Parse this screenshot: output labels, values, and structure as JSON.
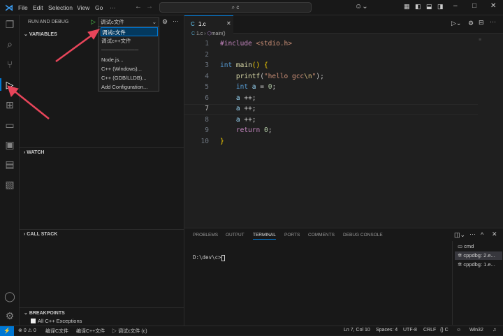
{
  "menu": [
    "File",
    "Edit",
    "Selection",
    "View",
    "Go",
    "···"
  ],
  "search": "c",
  "sidebar": {
    "title": "RUN AND DEBUG",
    "config": "调试c文件",
    "sections": {
      "variables": "VARIABLES",
      "watch": "WATCH",
      "callstack": "CALL STACK",
      "breakpoints": "BREAKPOINTS"
    },
    "breakpoint_item": "All C++ Exceptions"
  },
  "dropdown": [
    "调试c文件",
    "调试c++文件",
    "──────────",
    "Node.js...",
    "C++ (Windows)...",
    "C++ (GDB/LLDB)...",
    "Add Configuration..."
  ],
  "editor": {
    "tab": "1.c",
    "breadcrumb_file": "1.c",
    "breadcrumb_symbol": "main()",
    "lines": [
      "1",
      "2",
      "3",
      "4",
      "5",
      "6",
      "7",
      "8",
      "9",
      "10"
    ]
  },
  "panel": {
    "tabs": [
      "PROBLEMS",
      "OUTPUT",
      "TERMINAL",
      "PORTS",
      "COMMENTS",
      "DEBUG CONSOLE"
    ],
    "prompt": "D:\\dev\\c>",
    "terminals": [
      "cmd",
      "cppdbg: 2.e...",
      "cppdbg: 1.e..."
    ]
  },
  "status": {
    "errors": "0",
    "warnings": "0",
    "task1": "编译C文件",
    "task2": "编译C++文件",
    "debug": "调试c文件 (c)",
    "position": "Ln 7, Col 10",
    "spaces": "Spaces: 4",
    "encoding": "UTF-8",
    "eol": "CRLF",
    "language": "C",
    "platform": "Win32"
  },
  "colors": {
    "accent": "#0078d4",
    "arrow": "#e8455a"
  }
}
